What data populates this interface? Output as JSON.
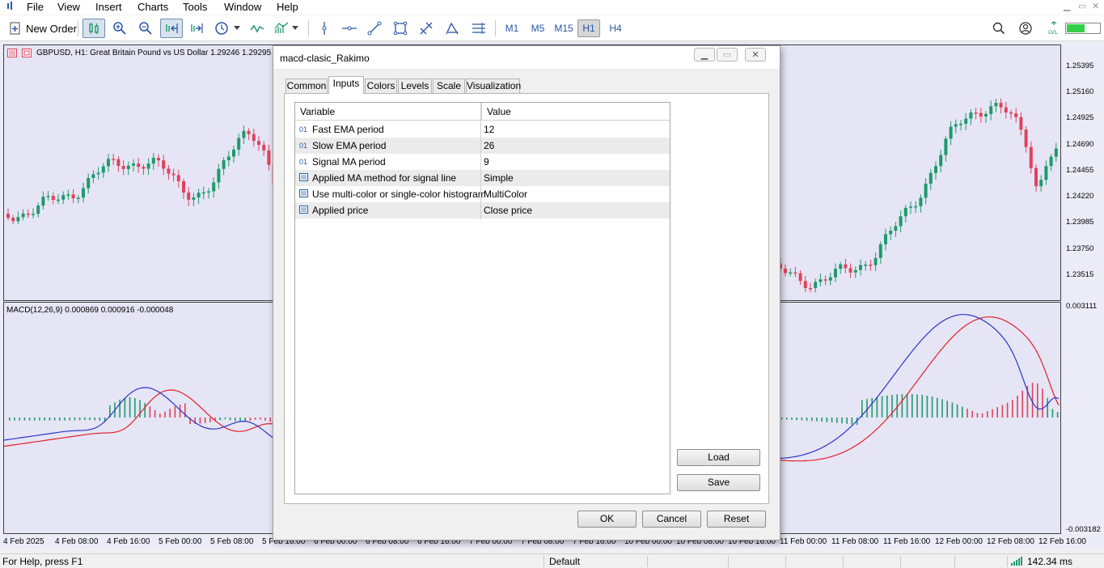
{
  "menu": {
    "items": [
      "File",
      "View",
      "Insert",
      "Charts",
      "Tools",
      "Window",
      "Help"
    ]
  },
  "toolbar": {
    "new_order_label": "New Order",
    "timeframes": [
      "M1",
      "M5",
      "M15",
      "H1",
      "H4"
    ],
    "active_timeframe": "H1",
    "icons": [
      "new-order-icon",
      "chart-type-icon",
      "zoom-in-icon",
      "zoom-out-icon",
      "autoscroll-icon",
      "chart-shift-icon",
      "clock-icon",
      "indicator-icon",
      "indicators-list-icon",
      "vertical-line-icon",
      "horizontal-line-icon",
      "trend-line-icon",
      "rectangle-icon",
      "fibonacci-icon",
      "andrews-pitchfork-icon",
      "channel-icon",
      "search-icon",
      "account-icon",
      "level-icon",
      "signal-strength-icon"
    ]
  },
  "chart": {
    "title": "GBPUSD, H1:  Great Britain Pound vs US Dollar  1.29246  1.29295  1",
    "macd_title": "MACD(12,26,9) 0.000869 0.000916 -0.000048",
    "price_ticks": [
      "1.25395",
      "1.25160",
      "1.24925",
      "1.24690",
      "1.24455",
      "1.24220",
      "1.23985",
      "1.23750",
      "1.23515"
    ],
    "macd_ticks": [
      "0.003111",
      "-0.003182"
    ],
    "time_ticks": [
      "4 Feb 2025",
      "4 Feb 08:00",
      "4 Feb 16:00",
      "5 Feb 00:00",
      "5 Feb 08:00",
      "5 Feb 16:00",
      "6 Feb 00:00",
      "6 Feb 08:00",
      "6 Feb 16:00",
      "7 Feb 00:00",
      "7 Feb 08:00",
      "7 Feb 16:00",
      "10 Feb 00:00",
      "10 Feb 08:00",
      "10 Feb 16:00",
      "11 Feb 00:00",
      "11 Feb 08:00",
      "11 Feb 16:00",
      "12 Feb 00:00",
      "12 Feb 08:00",
      "12 Feb 16:00"
    ],
    "colors": {
      "bull": "#1f9a6b",
      "bear": "#e0425c",
      "macd": "#2b36c8",
      "signal": "#e3202a",
      "background": "#e5e5f5"
    }
  },
  "dialog": {
    "title": "macd-clasic_Rakimo",
    "tabs": [
      "Common",
      "Inputs",
      "Colors",
      "Levels",
      "Scale",
      "Visualization"
    ],
    "active_tab": "Inputs",
    "columns": {
      "variable": "Variable",
      "value": "Value"
    },
    "rows": [
      {
        "icon": "int",
        "icon_text": "01",
        "variable": "Fast EMA period",
        "value": "12"
      },
      {
        "icon": "int",
        "icon_text": "01",
        "variable": "Slow EMA period",
        "value": "26"
      },
      {
        "icon": "int",
        "icon_text": "01",
        "variable": "Signal MA period",
        "value": "9"
      },
      {
        "icon": "enum",
        "variable": "Applied MA method for signal line",
        "value": "Simple"
      },
      {
        "icon": "enum",
        "variable": "Use multi-color or single-color histogram",
        "value": "MultiColor"
      },
      {
        "icon": "enum",
        "variable": "Applied price",
        "value": "Close price"
      }
    ],
    "buttons": {
      "load": "Load",
      "save": "Save",
      "ok": "OK",
      "cancel": "Cancel",
      "reset": "Reset"
    }
  },
  "statusbar": {
    "help": "For Help, press F1",
    "profile": "Default",
    "ping": "142.34 ms"
  }
}
